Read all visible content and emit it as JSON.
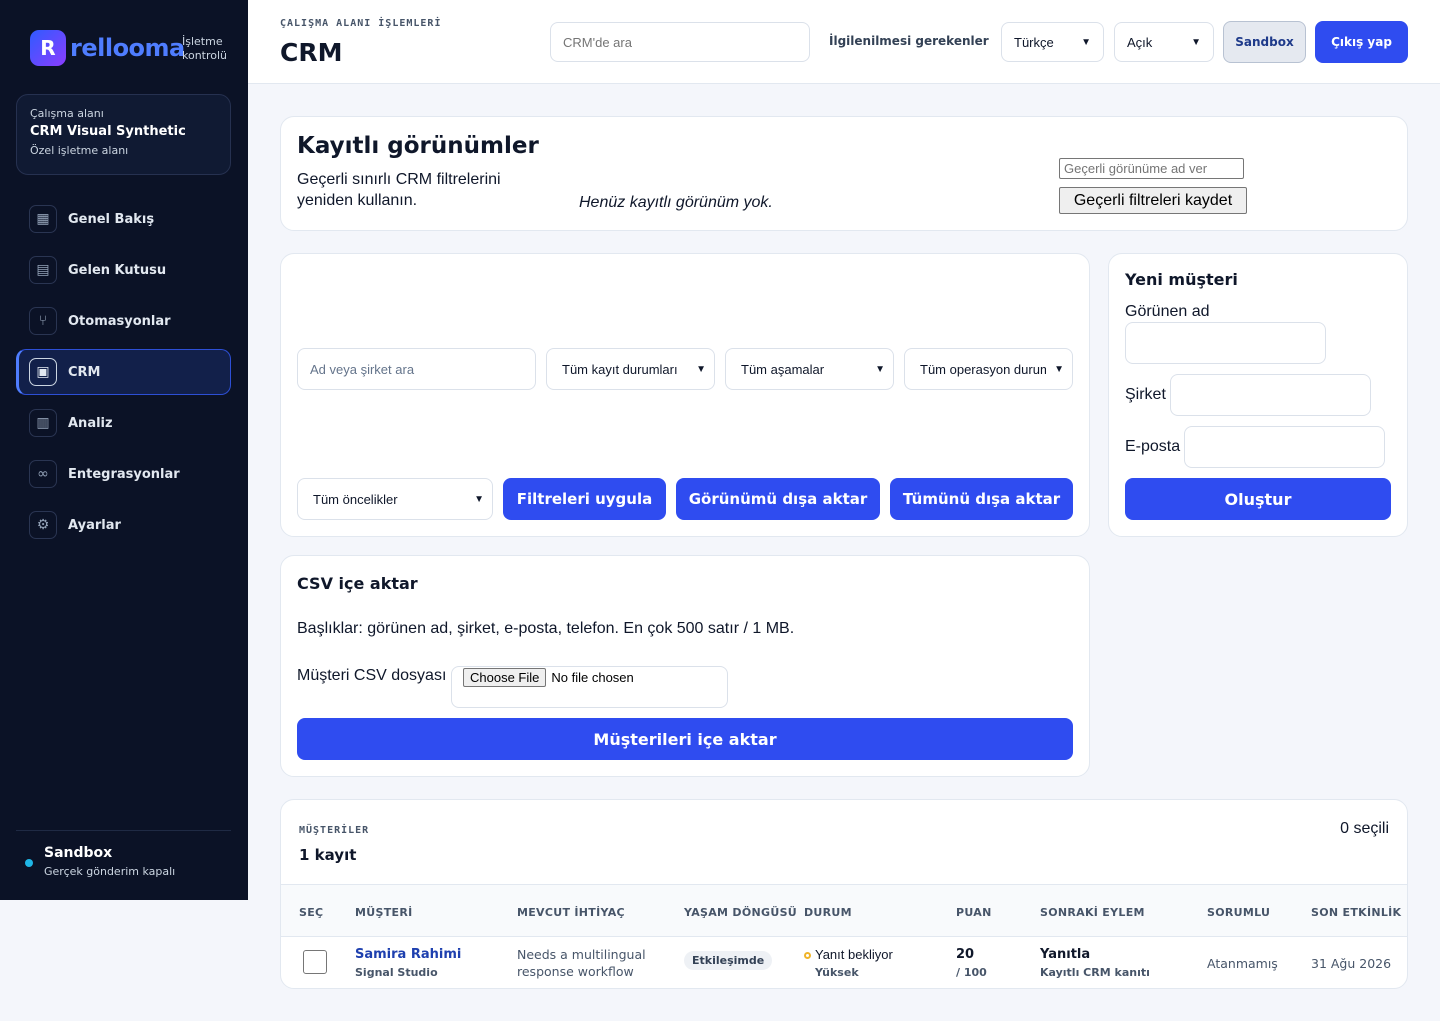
{
  "brand": {
    "mark": "R",
    "name": "rellooma",
    "sub": "İşletme kontrolü"
  },
  "workspace": {
    "kicker": "Çalışma alanı",
    "name": "CRM Visual Synthetic",
    "sub": "Özel işletme alanı"
  },
  "nav": [
    {
      "label": "Genel Bakış",
      "icon": "▦"
    },
    {
      "label": "Gelen Kutusu",
      "icon": "▤"
    },
    {
      "label": "Otomasyonlar",
      "icon": "⑂"
    },
    {
      "label": "CRM",
      "icon": "▣"
    },
    {
      "label": "Analiz",
      "icon": "▥"
    },
    {
      "label": "Entegrasyonlar",
      "icon": "∞"
    },
    {
      "label": "Ayarlar",
      "icon": "⚙"
    }
  ],
  "sidebar_footer": {
    "title": "Sandbox",
    "sub": "Gerçek gönderim kapalı"
  },
  "header": {
    "kicker": "ÇALIŞMA ALANI İŞLEMLERİ",
    "title": "CRM",
    "search_placeholder": "CRM'de ara",
    "attention_link": "İlgilenilmesi gerekenler",
    "language": "Türkçe",
    "theme": "Açık",
    "sandbox_label": "Sandbox",
    "logout_label": "Çıkış yap"
  },
  "saved_views": {
    "title": "Kayıtlı görünümler",
    "description": "Geçerli sınırlı CRM filtrelerini yeniden kullanın.",
    "empty": "Henüz kayıtlı görünüm yok.",
    "name_placeholder": "Geçerli görünüme ad ver",
    "save_label": "Geçerli filtreleri kaydet"
  },
  "filters": {
    "search_placeholder": "Ad veya şirket ara",
    "record_status": "Tüm kayıt durumları",
    "stage": "Tüm aşamalar",
    "ops_status": "Tüm operasyon durumları",
    "priority": "Tüm öncelikler",
    "apply_label": "Filtreleri uygula",
    "export_view_label": "Görünümü dışa aktar",
    "export_all_label": "Tümünü dışa aktar"
  },
  "new_customer": {
    "title": "Yeni müşteri",
    "display_name_label": "Görünen ad",
    "company_label": "Şirket",
    "email_label": "E-posta",
    "create_label": "Oluştur"
  },
  "csv_import": {
    "title": "CSV içe aktar",
    "description": "Başlıklar: görünen ad, şirket, e-posta, telefon. En çok 500 satır / 1 MB.",
    "file_label": "Müşteri CSV dosyası",
    "choose_label": "Choose File",
    "no_file": "No file chosen",
    "import_label": "Müşterileri içe aktar"
  },
  "customers": {
    "kicker": "MÜŞTERİLER",
    "count": "1 kayıt",
    "selected": "0 seçili",
    "columns": [
      "SEÇ",
      "MÜŞTERİ",
      "MEVCUT İHTİYAÇ",
      "YAŞAM DÖNGÜSÜ",
      "DURUM",
      "PUAN",
      "SONRAKİ EYLEM",
      "SORUMLU",
      "SON ETKİNLİK"
    ],
    "rows": [
      {
        "name": "Samira Rahimi",
        "company": "Signal Studio",
        "need": "Needs a multilingual response workflow",
        "lifecycle": "Etkileşimde",
        "status": "Yanıt bekliyor",
        "priority": "Yüksek",
        "score": "20",
        "score_max": "/ 100",
        "next_action": "Yanıtla",
        "next_action_sub": "Kayıtlı CRM kanıtı",
        "owner": "Atanmamış",
        "last_activity": "31 Ağu 2026"
      }
    ]
  },
  "colors": {
    "accent": "#2f4cf0",
    "sidebar": "#0b1226",
    "status_dot": "#f0b429",
    "link": "#1e40af"
  }
}
